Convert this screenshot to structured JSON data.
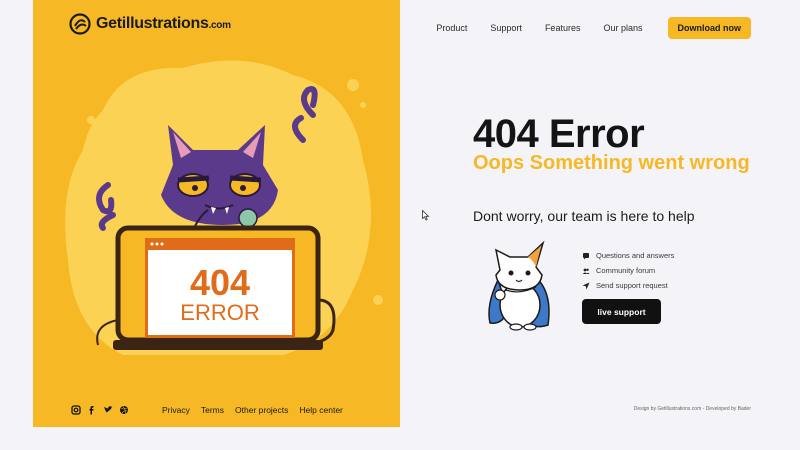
{
  "brand": {
    "name": "Getillustrations",
    "suffix": ".com"
  },
  "nav": {
    "items": [
      "Product",
      "Support",
      "Features",
      "Our plans"
    ],
    "cta": "Download now"
  },
  "main": {
    "title": "404 Error",
    "subtitle": "Oops Something went wrong",
    "help_text": "Dont worry, our team is here to help",
    "links": [
      {
        "label": "Questions and answers",
        "icon": "chat-icon"
      },
      {
        "label": "Community forum",
        "icon": "people-icon"
      },
      {
        "label": "Send support request",
        "icon": "send-icon"
      }
    ],
    "live_support": "live support"
  },
  "illustration": {
    "screen_line1": "404",
    "screen_line2": "ERROR"
  },
  "footer": {
    "social": [
      "instagram-icon",
      "facebook-icon",
      "twitter-icon",
      "dribbble-icon"
    ],
    "links": [
      "Privacy",
      "Terms",
      "Other projects",
      "Help center"
    ],
    "credit": "Design by Getillustrations.com - Developed by Bader"
  },
  "colors": {
    "accent": "#f6b825",
    "dark": "#111111",
    "cat_purple": "#5b3a8c"
  }
}
